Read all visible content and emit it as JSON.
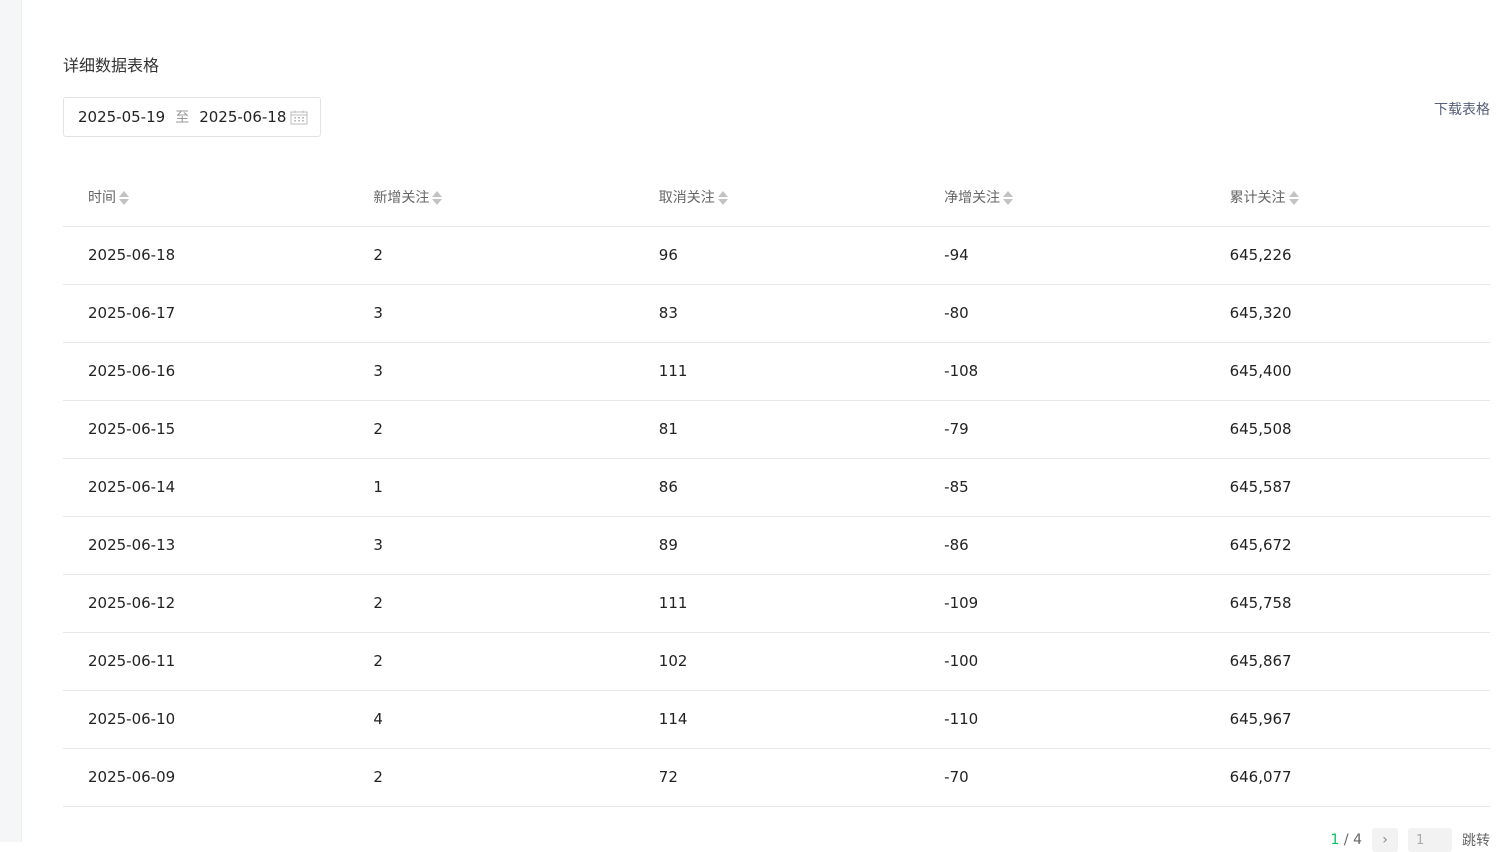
{
  "section": {
    "title": "详细数据表格"
  },
  "date_range": {
    "start": "2025-05-19",
    "separator": "至",
    "end": "2025-06-18"
  },
  "toolbar": {
    "download_label": "下载表格"
  },
  "table": {
    "columns": [
      "时间",
      "新增关注",
      "取消关注",
      "净增关注",
      "累计关注"
    ],
    "rows": [
      [
        "2025-06-18",
        "2",
        "96",
        "-94",
        "645,226"
      ],
      [
        "2025-06-17",
        "3",
        "83",
        "-80",
        "645,320"
      ],
      [
        "2025-06-16",
        "3",
        "111",
        "-108",
        "645,400"
      ],
      [
        "2025-06-15",
        "2",
        "81",
        "-79",
        "645,508"
      ],
      [
        "2025-06-14",
        "1",
        "86",
        "-85",
        "645,587"
      ],
      [
        "2025-06-13",
        "3",
        "89",
        "-86",
        "645,672"
      ],
      [
        "2025-06-12",
        "2",
        "111",
        "-109",
        "645,758"
      ],
      [
        "2025-06-11",
        "2",
        "102",
        "-100",
        "645,867"
      ],
      [
        "2025-06-10",
        "4",
        "114",
        "-110",
        "645,967"
      ],
      [
        "2025-06-09",
        "2",
        "72",
        "-70",
        "646,077"
      ]
    ]
  },
  "pagination": {
    "current": "1",
    "total": "/ 4",
    "input_placeholder": "1",
    "jump_label": "跳转"
  },
  "icons": {
    "calendar": "calendar-icon",
    "sort": "sort-icon",
    "next": "chevron-right-icon"
  },
  "colors": {
    "accent": "#07c160",
    "link": "#55607a"
  }
}
